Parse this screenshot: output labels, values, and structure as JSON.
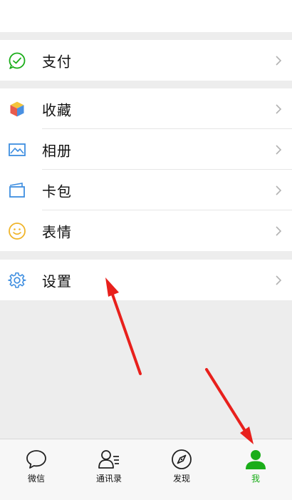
{
  "menu": {
    "pay": {
      "label": "支付",
      "icon": "wechat-pay-icon"
    },
    "favorites": {
      "label": "收藏",
      "icon": "cube-icon"
    },
    "album": {
      "label": "相册",
      "icon": "picture-icon"
    },
    "cards": {
      "label": "卡包",
      "icon": "card-wallet-icon"
    },
    "stickers": {
      "label": "表情",
      "icon": "smiley-icon"
    },
    "settings": {
      "label": "设置",
      "icon": "gear-icon"
    }
  },
  "tabbar": {
    "chats": {
      "label": "微信",
      "icon": "chat-bubble-icon"
    },
    "contacts": {
      "label": "通讯录",
      "icon": "contacts-icon"
    },
    "discover": {
      "label": "发现",
      "icon": "compass-icon"
    },
    "me": {
      "label": "我",
      "icon": "person-icon",
      "active": true
    }
  },
  "colors": {
    "accent": "#1aad19",
    "annotation_arrow": "#e8201c",
    "background": "#ededed"
  },
  "annotations": {
    "arrows": [
      "arrow-to-settings",
      "arrow-to-me-tab"
    ]
  }
}
